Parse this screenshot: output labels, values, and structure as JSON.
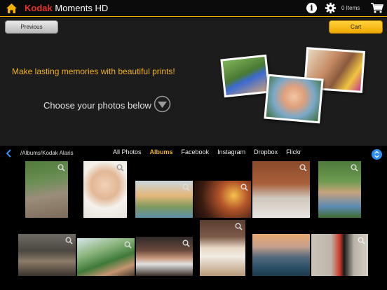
{
  "header": {
    "brand_kodak": "Kodak",
    "brand_moments": "Moments",
    "brand_hd": "HD",
    "items_count": "0 Items",
    "accent_color": "#f5b300",
    "icons": [
      "home-icon",
      "info-icon",
      "gear-icon",
      "cart-icon"
    ]
  },
  "toolbar": {
    "previous_label": "Previous",
    "cart_label": "Cart"
  },
  "banner": {
    "tagline": "Make lasting memories with beautiful prints!",
    "choose_text": "Choose your photos below"
  },
  "nav": {
    "path": "/Albums/Kodak Alaris",
    "tabs": [
      {
        "label": "All Photos",
        "active": false
      },
      {
        "label": "Albums",
        "active": true
      },
      {
        "label": "Facebook",
        "active": false
      },
      {
        "label": "Instagram",
        "active": false
      },
      {
        "label": "Dropbox",
        "active": false
      },
      {
        "label": "Flickr",
        "active": false
      }
    ]
  },
  "photos": {
    "count": 13
  }
}
